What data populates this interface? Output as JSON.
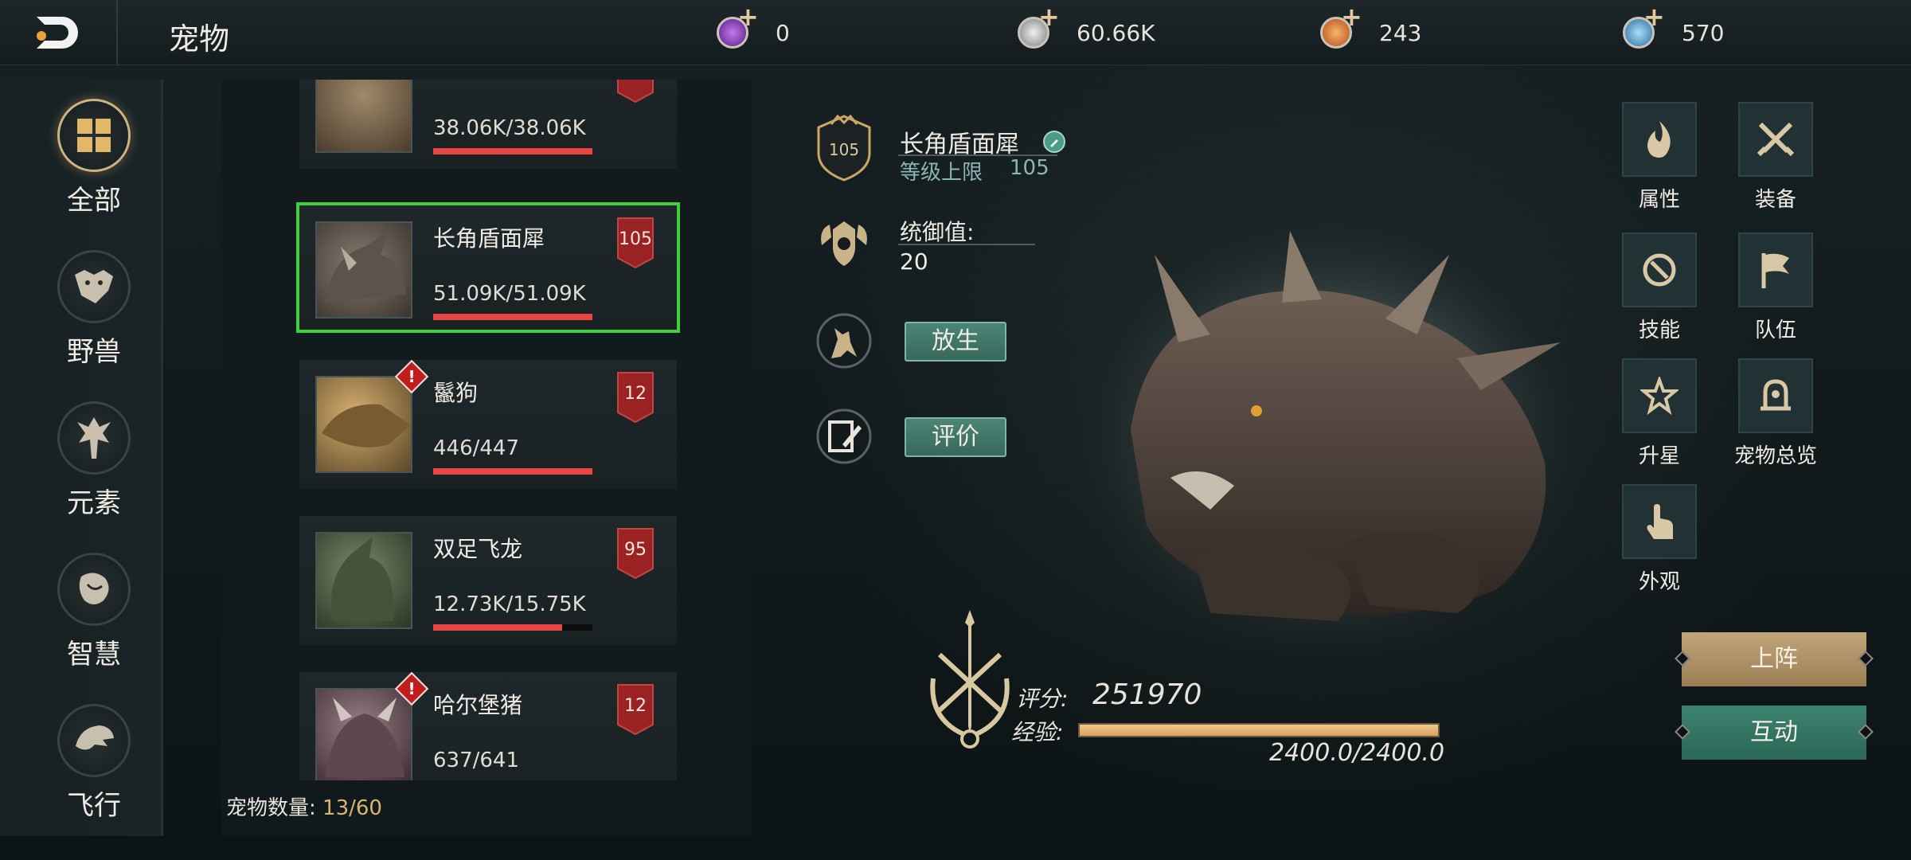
{
  "header": {
    "title": "宠物",
    "currencies": [
      {
        "name": "purple-gem-icon",
        "value": "0",
        "color": "#8a3fc8"
      },
      {
        "name": "silver-coin-icon",
        "value": "60.66K",
        "color": "#b8bcc0"
      },
      {
        "name": "fire-orb-icon",
        "value": "243",
        "color": "#d96a2a"
      },
      {
        "name": "blue-crystal-icon",
        "value": "570",
        "color": "#4aa0c8"
      }
    ]
  },
  "sidebar": {
    "items": [
      {
        "label": "全部",
        "icon": "grid-icon",
        "active": true
      },
      {
        "label": "野兽",
        "icon": "beast-head-icon"
      },
      {
        "label": "元素",
        "icon": "elemental-figure-icon"
      },
      {
        "label": "智慧",
        "icon": "wisdom-creature-icon"
      },
      {
        "label": "飞行",
        "icon": "eagle-head-icon"
      }
    ]
  },
  "pets": [
    {
      "name": "",
      "hp": "38.06K/38.06K",
      "hp_ratio": 1.0,
      "level": ""
    },
    {
      "name": "长角盾面犀",
      "hp": "51.09K/51.09K",
      "hp_ratio": 1.0,
      "level": "105",
      "selected": true
    },
    {
      "name": "鬣狗",
      "hp": "446/447",
      "hp_ratio": 0.998,
      "level": "12",
      "alert": "!"
    },
    {
      "name": "双足飞龙",
      "hp": "12.73K/15.75K",
      "hp_ratio": 0.808,
      "level": "95"
    },
    {
      "name": "哈尔堡猪",
      "hp": "637/641",
      "hp_ratio": 0.994,
      "level": "12",
      "alert": "!"
    }
  ],
  "pet_count": {
    "label": "宠物数量:",
    "value": "13/60"
  },
  "detail": {
    "name": "长角盾面犀",
    "badge_level": "105",
    "level_cap_label": "等级上限",
    "level_cap_value": "105",
    "command_label": "统御值:",
    "command_value": "20",
    "release_label": "放生",
    "review_label": "评价"
  },
  "stats": {
    "score_label": "评分:",
    "score_value": "251970",
    "exp_label": "经验:",
    "exp_value": "2400.0/2400.0",
    "exp_ratio": 1.0
  },
  "functions": [
    {
      "label": "属性",
      "icon": "flame-icon"
    },
    {
      "label": "装备",
      "icon": "crossed-swords-icon"
    },
    {
      "label": "技能",
      "icon": "skill-orb-icon"
    },
    {
      "label": "队伍",
      "icon": "flag-icon"
    },
    {
      "label": "升星",
      "icon": "star-icon"
    },
    {
      "label": "宠物总览",
      "icon": "overview-icon"
    },
    {
      "label": "外观",
      "icon": "touch-hand-icon"
    }
  ],
  "actions": {
    "deploy_label": "上阵",
    "interact_label": "互动"
  }
}
